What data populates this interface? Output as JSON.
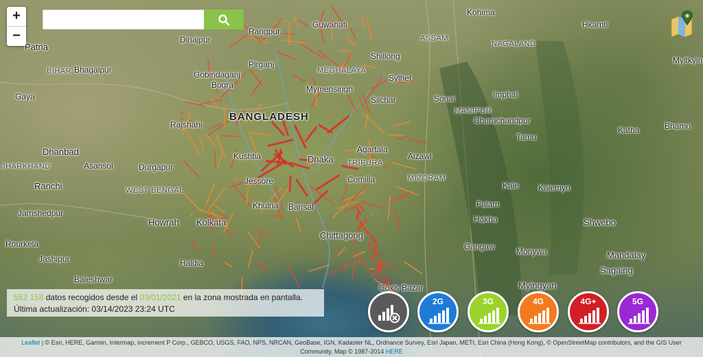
{
  "search": {
    "placeholder": "",
    "button_icon": "search-icon"
  },
  "zoom": {
    "in_label": "+",
    "out_label": "−"
  },
  "layers": {
    "icon": "map-layers-icon"
  },
  "places": {
    "country": "BANGLADESH",
    "regions": [
      "BIHAR",
      "JHARKHAND",
      "WEST BENGAL",
      "MEGHALAYA",
      "ASSAM",
      "NAGALAND",
      "MANIPUR",
      "TRIPURA",
      "MIZORAM"
    ],
    "cities": [
      "Patna",
      "Bhagalpur",
      "Gaya",
      "Dhanbad",
      "Asansol",
      "Durgapur",
      "Ranchi",
      "Jamshedpur",
      "Rourkela",
      "Jashipur",
      "Baleshwar",
      "Howrah",
      "Kolkata",
      "Haldia",
      "Rangpur",
      "Dinajpur",
      "Pirganj",
      "Gobindaganj",
      "Bogra",
      "Rajshahi",
      "Kushtia",
      "Jessore",
      "Khulna",
      "Barisal",
      "Dhaka",
      "Comilla",
      "Chittagong",
      "Sylhet",
      "Mymensingh",
      "Shillong",
      "Silchar",
      "Imphal",
      "Aizawl",
      "Kohima",
      "Guwahati",
      "Mandalay",
      "Monywa",
      "Shwebo",
      "Sagaing",
      "Myingyan",
      "Hkamti",
      "Myitkyina",
      "Bhamo",
      "Katha",
      "Kale",
      "Tamu",
      "Falam",
      "Hakha",
      "Gangaw",
      "Kalemyo",
      "Churachandpur",
      "Sonai",
      "Agartala",
      "Cox's Bazar"
    ],
    "sea_labels": []
  },
  "info": {
    "count": "552 158",
    "text_before": "datos recogidos desde el",
    "since_date": "03/01/2021",
    "text_after": "en la zona mostrada en pantalla.",
    "updated_label": "Última actualización:",
    "updated_value": "03/14/2023 23:24 UTC"
  },
  "tech_buttons": [
    {
      "label": "",
      "color": "#5a5a5a",
      "icon": "no-coverage-icon"
    },
    {
      "label": "2G",
      "color": "#1f7bd8",
      "icon": "signal-bars-icon"
    },
    {
      "label": "3G",
      "color": "#9bd32c",
      "icon": "signal-bars-icon"
    },
    {
      "label": "4G",
      "color": "#f47a1f",
      "icon": "signal-bars-icon"
    },
    {
      "label": "4G+",
      "color": "#d21f26",
      "icon": "signal-bars-icon"
    },
    {
      "label": "5G",
      "color": "#9b27d6",
      "icon": "signal-bars-icon"
    }
  ],
  "attribution": {
    "leaflet": "Leaflet",
    "text": "| © Esri, HERE, Garmin, Intermap, increment P Corp., GEBCO, USGS, FAO, NPS, NRCAN, GeoBase, IGN, Kadaster NL, Ordnance Survey, Esri Japan, METI, Esri China (Hong Kong), © OpenStreetMap contributors, and the GIS User",
    "text2": "Community, Map © 1987-2014",
    "here": "HERE"
  }
}
